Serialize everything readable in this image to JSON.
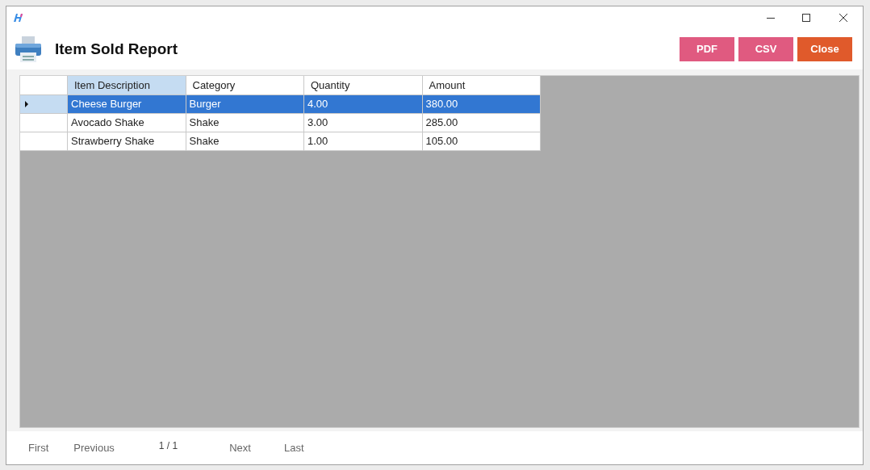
{
  "window": {
    "title": "Item Sold Report"
  },
  "buttons": [
    {
      "label": "PDF",
      "kind": "export"
    },
    {
      "label": "CSV",
      "kind": "export"
    },
    {
      "label": "Close",
      "kind": "close"
    }
  ],
  "table": {
    "columns": [
      {
        "label": "Item Description",
        "selected": true
      },
      {
        "label": "Category",
        "selected": false
      },
      {
        "label": "Quantity",
        "selected": false
      },
      {
        "label": "Amount",
        "selected": false
      }
    ],
    "rows": [
      {
        "selected": true,
        "cells": [
          "Cheese Burger",
          "Burger",
          "4.00",
          "380.00"
        ]
      },
      {
        "selected": false,
        "cells": [
          "Avocado Shake",
          "Shake",
          "3.00",
          "285.00"
        ]
      },
      {
        "selected": false,
        "cells": [
          "Strawberry Shake",
          "Shake",
          "1.00",
          "105.00"
        ]
      }
    ]
  },
  "pager": {
    "first": "First",
    "previous": "Previous",
    "page": "1 / 1",
    "next": "Next",
    "last": "Last"
  }
}
